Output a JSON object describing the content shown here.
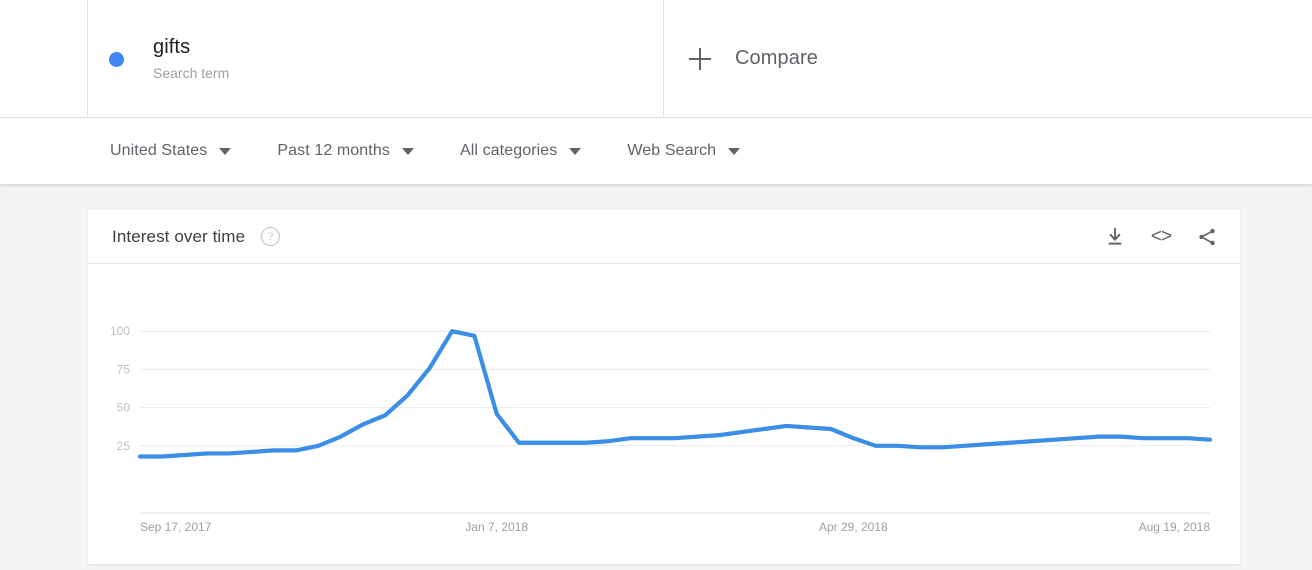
{
  "terms": [
    {
      "label": "gifts",
      "sublabel": "Search term",
      "color": "#4285f4",
      "dot": "legend-dot"
    }
  ],
  "compare": {
    "label": "Compare",
    "icon": "plus-icon"
  },
  "filters": [
    {
      "label": "United States",
      "icon": "chevron-down-icon"
    },
    {
      "label": "Past 12 months",
      "icon": "chevron-down-icon"
    },
    {
      "label": "All categories",
      "icon": "chevron-down-icon"
    },
    {
      "label": "Web Search",
      "icon": "chevron-down-icon"
    }
  ],
  "card": {
    "title": "Interest over time",
    "help": "?",
    "actions": [
      {
        "name": "download-icon",
        "glyph": ""
      },
      {
        "name": "embed-icon",
        "glyph": "<>"
      },
      {
        "name": "share-icon",
        "glyph": ""
      }
    ]
  },
  "chart_data": {
    "type": "line",
    "title": "Interest over time",
    "xlabel": "",
    "ylabel": "",
    "ylim": [
      0,
      108
    ],
    "grid": true,
    "legend_position": "top",
    "yticks": [
      25,
      50,
      75,
      100
    ],
    "xticks": [
      "Sep 17, 2017",
      "Jan 7, 2018",
      "Apr 29, 2018",
      "Aug 19, 2018"
    ],
    "xtick_index": [
      0,
      16,
      32,
      48
    ],
    "series": [
      {
        "name": "gifts",
        "color": "#3a8ee6",
        "x": [
          "Sep 17, 2017",
          "Sep 24, 2017",
          "Oct 1, 2017",
          "Oct 8, 2017",
          "Oct 15, 2017",
          "Oct 22, 2017",
          "Oct 29, 2017",
          "Nov 5, 2017",
          "Nov 12, 2017",
          "Nov 19, 2017",
          "Nov 26, 2017",
          "Dec 3, 2017",
          "Dec 10, 2017",
          "Dec 17, 2017",
          "Dec 24, 2017",
          "Dec 31, 2017",
          "Jan 7, 2018",
          "Jan 14, 2018",
          "Jan 21, 2018",
          "Jan 28, 2018",
          "Feb 4, 2018",
          "Feb 11, 2018",
          "Feb 18, 2018",
          "Feb 25, 2018",
          "Mar 4, 2018",
          "Mar 11, 2018",
          "Mar 18, 2018",
          "Mar 25, 2018",
          "Apr 1, 2018",
          "Apr 8, 2018",
          "Apr 15, 2018",
          "Apr 22, 2018",
          "Apr 29, 2018",
          "May 6, 2018",
          "May 13, 2018",
          "May 20, 2018",
          "May 27, 2018",
          "Jun 3, 2018",
          "Jun 10, 2018",
          "Jun 17, 2018",
          "Jun 24, 2018",
          "Jul 1, 2018",
          "Jul 8, 2018",
          "Jul 15, 2018",
          "Jul 22, 2018",
          "Jul 29, 2018",
          "Aug 5, 2018",
          "Aug 12, 2018",
          "Aug 19, 2018"
        ],
        "values": [
          18,
          18,
          19,
          20,
          20,
          21,
          22,
          22,
          25,
          31,
          39,
          45,
          58,
          76,
          100,
          97,
          46,
          27,
          27,
          27,
          27,
          28,
          30,
          30,
          30,
          31,
          32,
          34,
          36,
          38,
          37,
          36,
          30,
          25,
          25,
          24,
          24,
          25,
          26,
          27,
          28,
          29,
          30,
          31,
          31,
          30,
          30,
          30,
          29
        ]
      }
    ]
  }
}
